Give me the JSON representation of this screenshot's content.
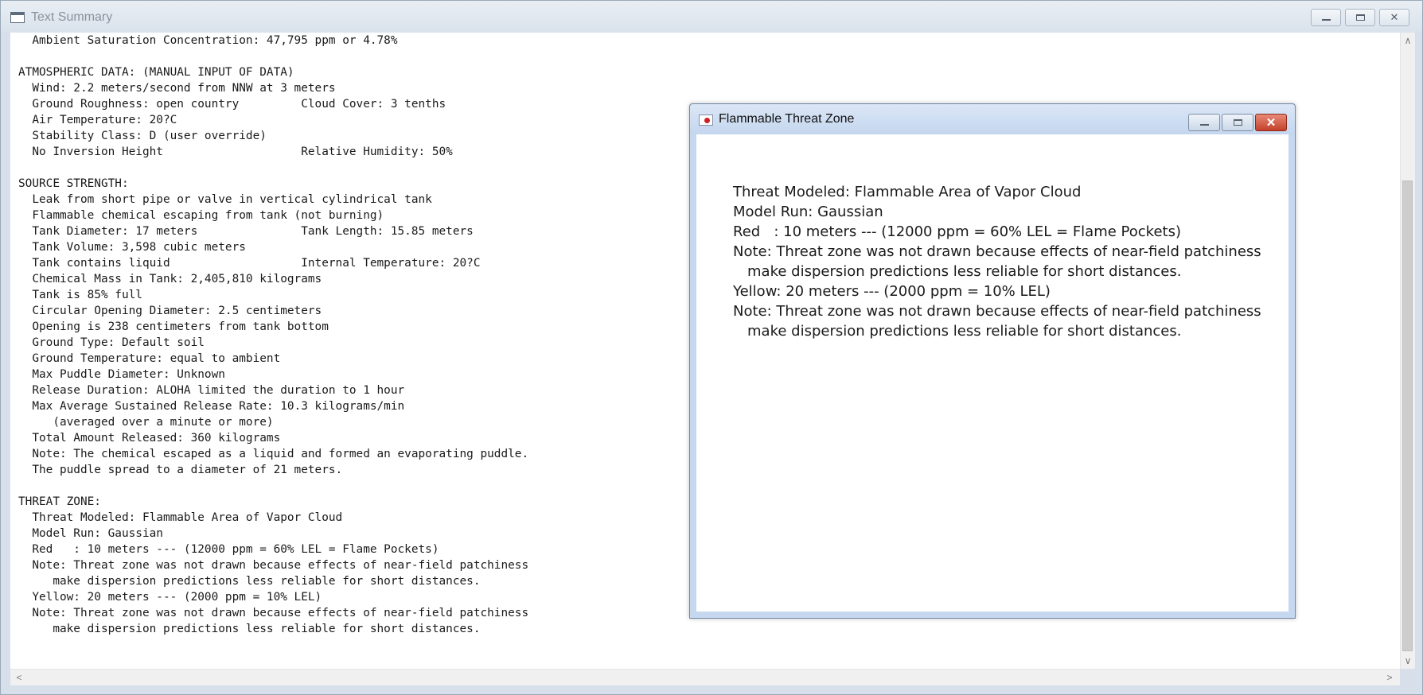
{
  "main_window": {
    "title": "Text Summary",
    "controls": {
      "minimize": "",
      "maximize": "",
      "close": "✕"
    },
    "summary_lines": [
      "  Ambient Saturation Concentration: 47,795 ppm or 4.78%",
      "",
      "ATMOSPHERIC DATA: (MANUAL INPUT OF DATA)",
      "  Wind: 2.2 meters/second from NNW at 3 meters",
      "  Ground Roughness: open country         Cloud Cover: 3 tenths",
      "  Air Temperature: 20?C",
      "  Stability Class: D (user override)",
      "  No Inversion Height                    Relative Humidity: 50%",
      "",
      "SOURCE STRENGTH:",
      "  Leak from short pipe or valve in vertical cylindrical tank",
      "  Flammable chemical escaping from tank (not burning)",
      "  Tank Diameter: 17 meters               Tank Length: 15.85 meters",
      "  Tank Volume: 3,598 cubic meters",
      "  Tank contains liquid                   Internal Temperature: 20?C",
      "  Chemical Mass in Tank: 2,405,810 kilograms",
      "  Tank is 85% full",
      "  Circular Opening Diameter: 2.5 centimeters",
      "  Opening is 238 centimeters from tank bottom",
      "  Ground Type: Default soil",
      "  Ground Temperature: equal to ambient",
      "  Max Puddle Diameter: Unknown",
      "  Release Duration: ALOHA limited the duration to 1 hour",
      "  Max Average Sustained Release Rate: 10.3 kilograms/min",
      "     (averaged over a minute or more)",
      "  Total Amount Released: 360 kilograms",
      "  Note: The chemical escaped as a liquid and formed an evaporating puddle.",
      "  The puddle spread to a diameter of 21 meters.",
      "",
      "THREAT ZONE:",
      "  Threat Modeled: Flammable Area of Vapor Cloud",
      "  Model Run: Gaussian",
      "  Red   : 10 meters --- (12000 ppm = 60% LEL = Flame Pockets)",
      "  Note: Threat zone was not drawn because effects of near-field patchiness",
      "     make dispersion predictions less reliable for short distances.",
      "  Yellow: 20 meters --- (2000 ppm = 10% LEL)",
      "  Note: Threat zone was not drawn because effects of near-field patchiness",
      "     make dispersion predictions less reliable for short distances."
    ],
    "scrollbar": {
      "up_arrow": "∧",
      "down_arrow": "∨",
      "left_arrow": "<",
      "right_arrow": ">"
    }
  },
  "threat_window": {
    "title": "Flammable Threat Zone",
    "close_label": "✕",
    "lines": [
      {
        "text": "Threat Modeled: Flammable Area of Vapor Cloud",
        "indent": false
      },
      {
        "text": "Model Run: Gaussian",
        "indent": false
      },
      {
        "text": "Red   : 10 meters --- (12000 ppm = 60% LEL = Flame Pockets)",
        "indent": false
      },
      {
        "text": "Note: Threat zone was not drawn because effects of near-field patchiness",
        "indent": false
      },
      {
        "text": "make dispersion predictions less reliable for short distances.",
        "indent": true
      },
      {
        "text": "Yellow: 20 meters --- (2000 ppm = 10% LEL)",
        "indent": false
      },
      {
        "text": "Note: Threat zone was not drawn because effects of near-field patchiness",
        "indent": false
      },
      {
        "text": "make dispersion predictions less reliable for short distances.",
        "indent": true
      }
    ]
  },
  "colors": {
    "close_button_red": "#c4402a",
    "titlebar_blue": "#c4d6ee",
    "icon_red": "#d02020"
  },
  "icons": {
    "main_app": "text-summary-window-icon",
    "threat_app": "threat-zone-window-icon"
  }
}
